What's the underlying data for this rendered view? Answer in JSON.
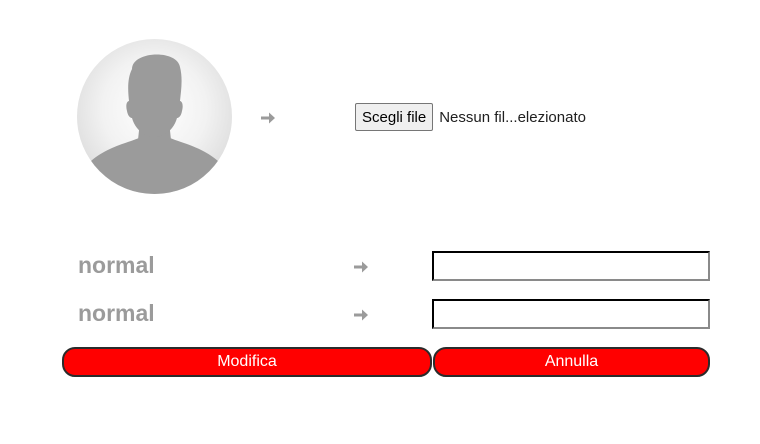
{
  "avatar": {
    "icon": "user-silhouette-icon",
    "background": "#e6e6e6",
    "silhouette_color": "#9b9b9b"
  },
  "file_upload": {
    "button_label": "Scegli file",
    "status_text": "Nessun fil...elezionato"
  },
  "fields": [
    {
      "label": "normal",
      "value": ""
    },
    {
      "label": "normal",
      "value": ""
    }
  ],
  "arrow_icon": "arrow-right-icon",
  "arrow_color": "#9b9b9b",
  "buttons": {
    "modify_label": "Modifica",
    "cancel_label": "Annulla",
    "color": "#ff0000"
  }
}
